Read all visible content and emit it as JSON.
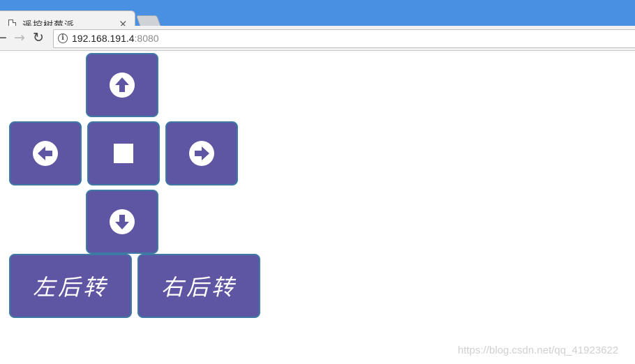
{
  "browser": {
    "tab": {
      "title": "遥控树莓派",
      "close_glyph": "×"
    },
    "toolbar": {
      "back_glyph": "←",
      "forward_glyph": "→",
      "reload_glyph": "↻",
      "info_glyph": "i",
      "url_host": "192.168.191.4",
      "url_port": ":8080"
    }
  },
  "controls": {
    "up": {
      "icon": "arrow-up-circle-icon"
    },
    "left": {
      "icon": "arrow-left-circle-icon"
    },
    "stop": {
      "icon": "stop-square-icon"
    },
    "right": {
      "icon": "arrow-right-circle-icon"
    },
    "down": {
      "icon": "arrow-down-circle-icon"
    },
    "left_back_label": "左后转",
    "right_back_label": "右后转"
  },
  "colors": {
    "button_fill": "#5f56a3",
    "button_border": "#3f79a5",
    "chrome_blue": "#4a90e2"
  },
  "watermark": "https://blog.csdn.net/qq_41923622"
}
